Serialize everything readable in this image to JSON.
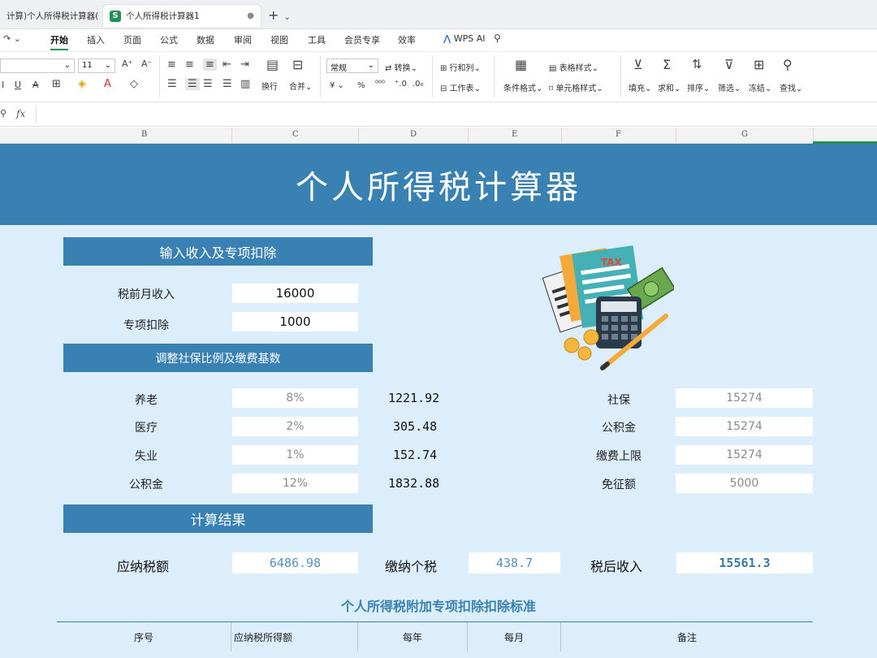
{
  "tabs": {
    "inactive_label": "计算)个人所得税计算器(",
    "active_label": "个人所得税计算器1",
    "active_icon": "S",
    "new_tab": "+"
  },
  "menu": [
    "开始",
    "插入",
    "页面",
    "公式",
    "数据",
    "审阅",
    "视图",
    "工具",
    "会员专享",
    "效率"
  ],
  "wps_ai": "WPS AI",
  "toolbar": {
    "font_size": "11",
    "number_format": "常规",
    "convert": "转换",
    "rows_cols": "行和列",
    "worksheet": "工作表",
    "wrap": "换行",
    "merge": "合并",
    "cond_format": "条件格式",
    "table_style": "表格样式",
    "cell_style": "单元格样式",
    "fill": "填充",
    "sum": "求和",
    "sort": "排序",
    "filter": "筛选",
    "freeze": "冻结",
    "find": "查找"
  },
  "formula": {
    "fx": "fx"
  },
  "columns": [
    "B",
    "C",
    "D",
    "E",
    "F",
    "G"
  ],
  "sheet": {
    "title": "个人所得税计算器",
    "section_input": "输入收入及专项扣除",
    "section_social": "调整社保比例及缴费基数",
    "section_result": "计算结果",
    "input": [
      {
        "label": "税前月收入",
        "value": "16000"
      },
      {
        "label": "专项扣除",
        "value": "1000"
      }
    ],
    "social": [
      {
        "label": "养老",
        "rate": "8%",
        "amount": "1221.92",
        "right_label": "社保",
        "right_value": "15274"
      },
      {
        "label": "医疗",
        "rate": "2%",
        "amount": "305.48",
        "right_label": "公积金",
        "right_value": "15274"
      },
      {
        "label": "失业",
        "rate": "1%",
        "amount": "152.74",
        "right_label": "缴费上限",
        "right_value": "15274"
      },
      {
        "label": "公积金",
        "rate": "12%",
        "amount": "1832.88",
        "right_label": "免征额",
        "right_value": "5000"
      }
    ],
    "result": {
      "taxable_label": "应纳税额",
      "taxable_value": "6486.98",
      "tax_label": "缴纳个税",
      "tax_value": "438.7",
      "net_label": "税后收入",
      "net_value": "15561.3"
    },
    "standard_title": "个人所得税附加专项扣除扣除标准",
    "table_headers": [
      "序号",
      "应纳税所得额",
      "每年",
      "每月",
      "备注"
    ],
    "illustration_text": "TAX"
  },
  "colors": {
    "primary": "#3a81b3",
    "sheet_bg": "#dceefb",
    "ribbon_green": "#1d8f57"
  }
}
